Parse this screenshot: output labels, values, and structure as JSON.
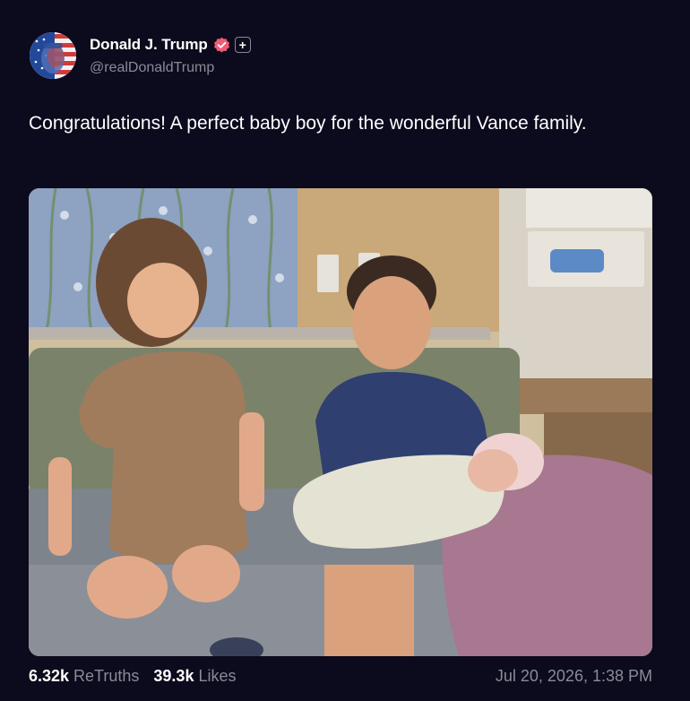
{
  "author": {
    "display_name": "Donald J. Trump",
    "handle": "@realDonaldTrump",
    "avatar_icon": "flag-portrait-avatar",
    "verified_icon": "verified-badge-icon",
    "verified_color": "#ef5d74",
    "plus_icon": "plus-icon"
  },
  "post": {
    "text": "Congratulations! A perfect baby boy for the wonderful Vance family."
  },
  "media": {
    "type": "photo"
  },
  "stats": {
    "retruths_count": "6.32k",
    "retruths_label": "ReTruths",
    "likes_count": "39.3k",
    "likes_label": "Likes"
  },
  "timestamp": "Jul 20, 2026, 1:38 PM",
  "colors": {
    "background": "#0c0a1d",
    "muted_text": "#8b8a96",
    "primary_text": "#ffffff"
  }
}
